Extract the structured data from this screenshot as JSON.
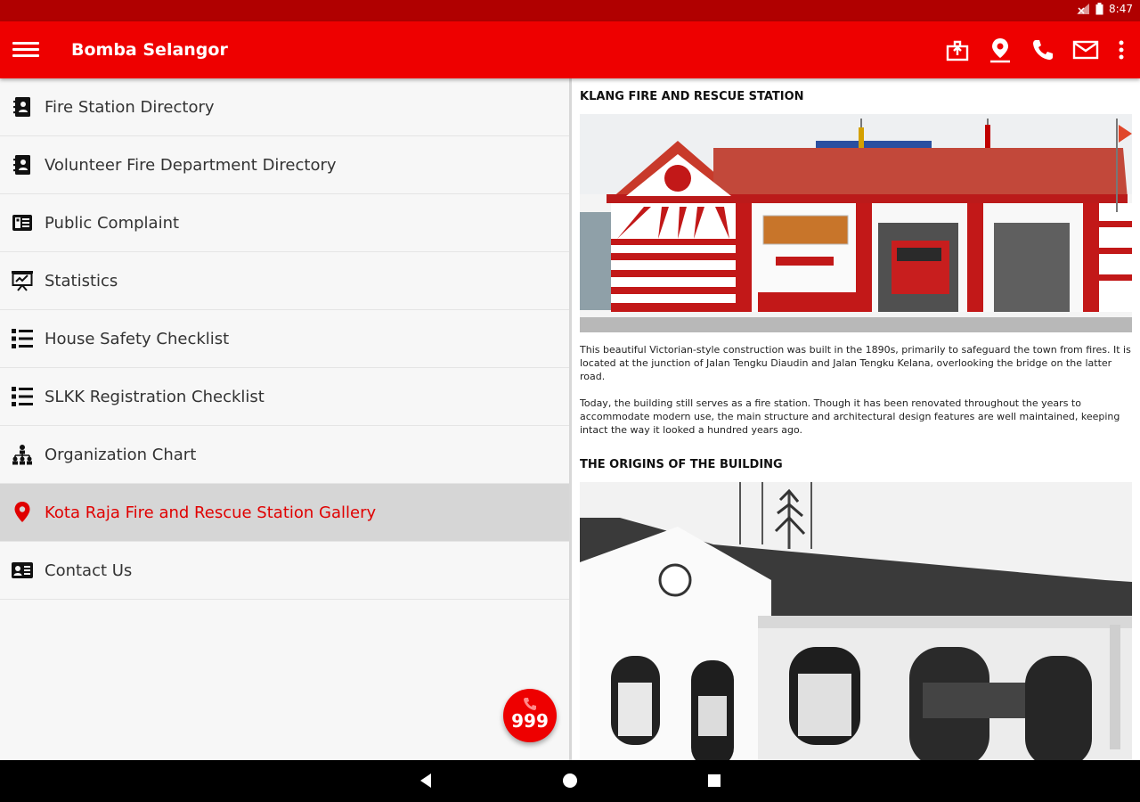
{
  "status_bar": {
    "time": "8:47"
  },
  "app_bar": {
    "title": "Bomba Selangor",
    "icons": [
      "menu-icon",
      "share-icon",
      "location-pin-icon",
      "phone-icon",
      "mail-icon",
      "more-vert-icon"
    ]
  },
  "sidebar": {
    "items": [
      {
        "label": "Fire Station Directory",
        "icon": "contact-book-icon"
      },
      {
        "label": "Volunteer Fire Department Directory",
        "icon": "contact-book-icon"
      },
      {
        "label": "Public Complaint",
        "icon": "complaint-form-icon"
      },
      {
        "label": "Statistics",
        "icon": "presentation-chart-icon"
      },
      {
        "label": "House Safety Checklist",
        "icon": "checklist-icon"
      },
      {
        "label": "SLKK Registration Checklist",
        "icon": "checklist-icon"
      },
      {
        "label": "Organization Chart",
        "icon": "org-chart-icon"
      },
      {
        "label": "Kota Raja Fire and Rescue Station Gallery",
        "icon": "location-pin-icon",
        "active": true
      },
      {
        "label": "Contact Us",
        "icon": "contact-card-icon"
      }
    ]
  },
  "content": {
    "section1_title": "KLANG FIRE AND RESCUE STATION",
    "para1": "This beautiful Victorian-style construction was built in the 1890s, primarily to safeguard the town from fires. It is located at the junction of Jalan Tengku Diaudin and Jalan Tengku Kelana, overlooking the bridge on the latter road.",
    "para2": "Today, the building still serves as a fire station. Though it has been renovated throughout the years to accommodate modern use, the main structure and architectural design features are well maintained, keeping intact the way it looked a hundred years ago.",
    "section2_title": "THE ORIGINS OF THE BUILDING"
  },
  "fab": {
    "label": "999",
    "icon": "phone-icon"
  },
  "nav_bar": {
    "icons": [
      "back-icon",
      "home-icon",
      "recents-icon"
    ]
  },
  "colors": {
    "primary": "#ee0000",
    "status_bar": "#b00000",
    "active_item_bg": "#d6d6d6"
  }
}
